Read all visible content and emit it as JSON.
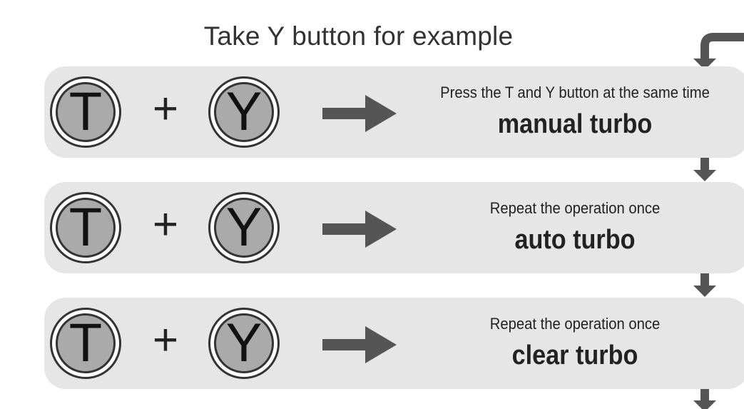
{
  "title": "Take Y button for example",
  "colors": {
    "panel": "#e6e6e6",
    "button_fill": "#aaaaaa",
    "arrow": "#555555",
    "text": "#222222"
  },
  "rows": [
    {
      "left_key": "T",
      "plus": "+",
      "right_key": "Y",
      "description": "Press the T and Y button at the same time",
      "mode": "manual turbo"
    },
    {
      "left_key": "T",
      "plus": "+",
      "right_key": "Y",
      "description": "Repeat the operation once",
      "mode": "auto turbo"
    },
    {
      "left_key": "T",
      "plus": "+",
      "right_key": "Y",
      "description": "Repeat the operation once",
      "mode": "clear turbo"
    }
  ]
}
